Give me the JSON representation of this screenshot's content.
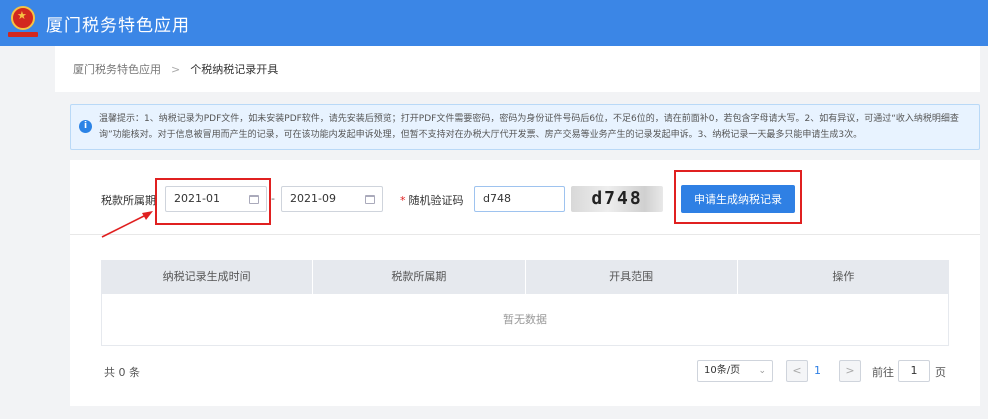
{
  "header": {
    "title": "厦门税务特色应用"
  },
  "breadcrumb": {
    "parent": "厦门税务特色应用",
    "separator": ">",
    "current": "个税纳税记录开具"
  },
  "notice": {
    "icon": "info-icon",
    "text": "温馨提示：1、纳税记录为PDF文件，如未安装PDF软件，请先安装后预览；打开PDF文件需要密码，密码为身份证件号码后6位，不足6位的，请在前面补0，若包含字母请大写。2、如有异议，可通过“收入纳税明细查询”功能核对。对于信息被冒用而产生的记录，可在该功能内发起申诉处理，但暂不支持对在办税大厅代开发票、房产交易等业务产生的记录发起申诉。3、纳税记录一天最多只能申请生成3次。"
  },
  "form": {
    "period_label": "税款所属期",
    "start_value": "2021-01",
    "range_sep": "-",
    "end_value": "2021-09",
    "required_mark": "*",
    "captcha_label": "随机验证码",
    "captcha_input_value": "d748",
    "captcha_image_text": "d748",
    "apply_button": "申请生成纳税记录"
  },
  "table": {
    "columns": [
      "纳税记录生成时间",
      "税款所属期",
      "开具范围",
      "操作"
    ],
    "rows": [],
    "empty_text": "暂无数据"
  },
  "pagination": {
    "total": "共 0 条",
    "page_size": "10条/页",
    "prev": "<",
    "current_page": "1",
    "next": ">",
    "goto_prefix": "前往",
    "goto_value": "1",
    "goto_suffix": "页"
  },
  "colors": {
    "brand": "#3b86e6",
    "primary_button": "#2f80e4",
    "annotation": "#e02020"
  }
}
